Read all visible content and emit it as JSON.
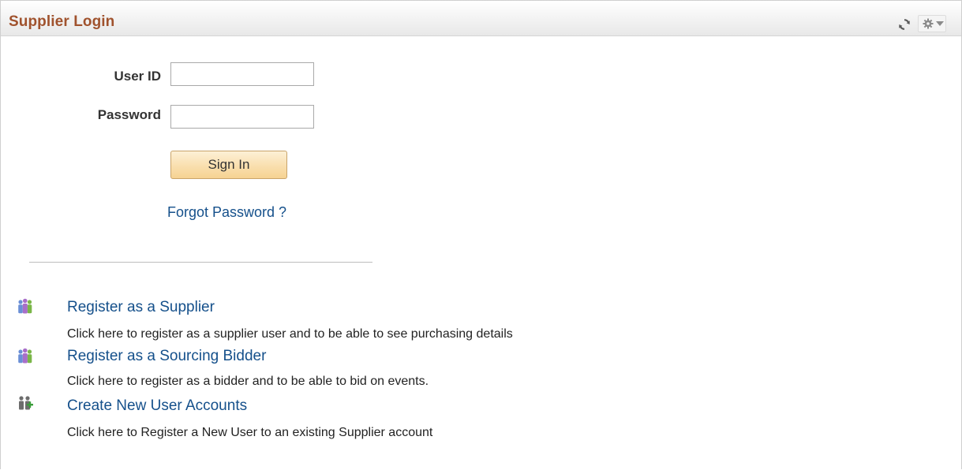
{
  "header": {
    "title": "Supplier Login",
    "refresh_icon": "refresh-icon",
    "options_icon": "gear-icon"
  },
  "login_form": {
    "user_id_label": "User ID",
    "user_id_value": "",
    "password_label": "Password",
    "password_value": "",
    "sign_in_label": "Sign In",
    "forgot_password_label": "Forgot Password ?"
  },
  "actions": [
    {
      "icon": "users-group-icon",
      "link": "Register as a Supplier",
      "description": "Click here to register as a supplier user and to be able to see purchasing details"
    },
    {
      "icon": "users-group-icon",
      "link": "Register as a Sourcing Bidder",
      "description": "Click here to register as a bidder and to be able to bid on events."
    },
    {
      "icon": "add-users-icon",
      "link": "Create New User Accounts",
      "description": "Click here to Register a New User to an existing Supplier account"
    }
  ],
  "colors": {
    "title": "#a0522d",
    "link": "#15508b",
    "button_top": "#fdf0d6",
    "button_bottom": "#f6d292"
  }
}
